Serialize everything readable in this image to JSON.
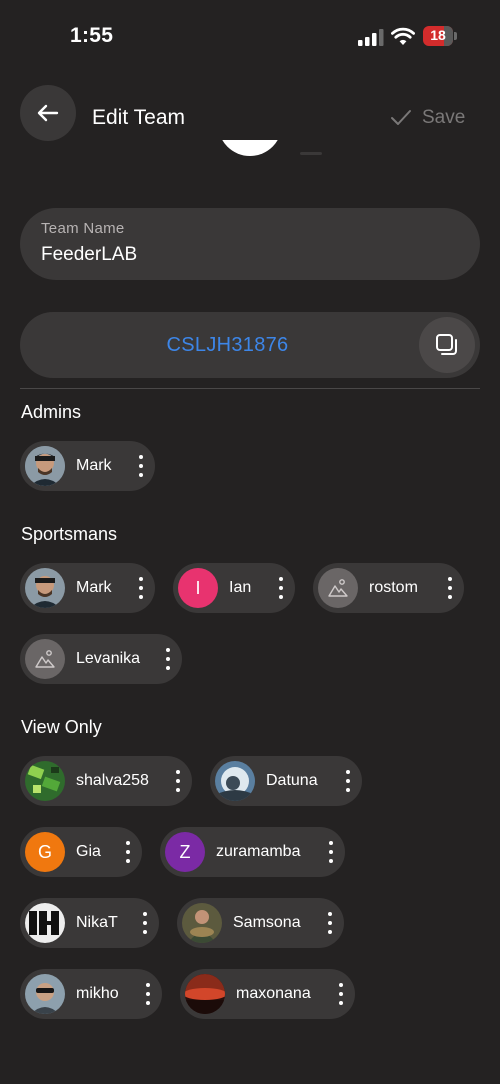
{
  "status": {
    "time": "1:55",
    "battery": "18"
  },
  "header": {
    "title": "Edit Team",
    "save_label": "Save"
  },
  "team_name": {
    "label": "Team Name",
    "value": "FeederLAB"
  },
  "team_code": "CSLJH31876",
  "sections": {
    "admins": "Admins",
    "sportsmans": "Sportsmans",
    "view_only": "View Only"
  },
  "admins": [
    {
      "name": "Mark"
    }
  ],
  "sportsmans": [
    {
      "name": "Mark"
    },
    {
      "name": "Ian",
      "initial": "I",
      "color": "#e8336f"
    },
    {
      "name": "rostom"
    },
    {
      "name": "Levanika"
    }
  ],
  "view_only": [
    {
      "name": "shalva258"
    },
    {
      "name": "Datuna"
    },
    {
      "name": "Gia",
      "initial": "G",
      "color": "#f0780f"
    },
    {
      "name": "zuramamba",
      "initial": "Z",
      "color": "#7b2aa5"
    },
    {
      "name": "NikaT"
    },
    {
      "name": "Samsona"
    },
    {
      "name": "mikho"
    },
    {
      "name": "maxonana"
    }
  ],
  "colors": {
    "accent": "#3d86e8",
    "background": "#242222",
    "surface": "#3a3838"
  }
}
